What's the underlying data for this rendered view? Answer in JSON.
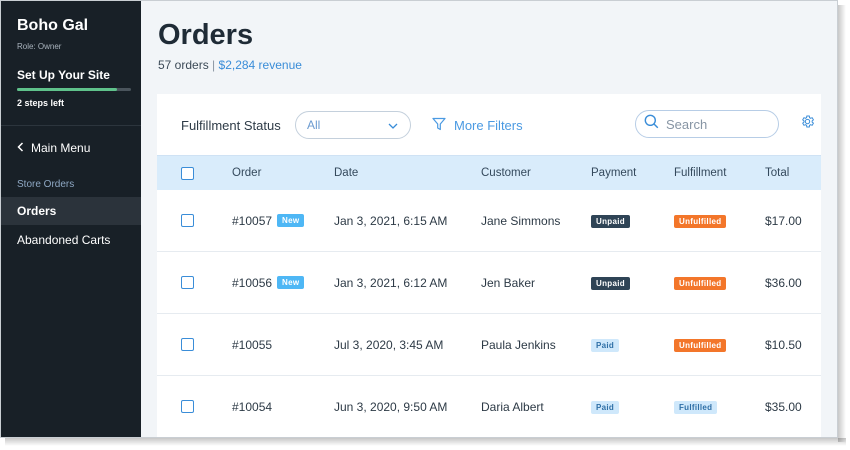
{
  "sidebar": {
    "site_name": "Boho Gal",
    "role": "Role: Owner",
    "setup_title": "Set Up Your Site",
    "setup_progress_percent": 88,
    "steps_left": "2 steps left",
    "main_menu_label": "Main Menu",
    "section_label": "Store Orders",
    "items": [
      {
        "label": "Orders",
        "active": true
      },
      {
        "label": "Abandoned Carts",
        "active": false
      }
    ]
  },
  "header": {
    "title": "Orders",
    "order_count": "57 orders",
    "separator": "|",
    "revenue": "$2,284 revenue"
  },
  "filters": {
    "fulfillment_label": "Fulfillment Status",
    "fulfillment_value": "All",
    "more_filters_label": "More Filters",
    "search_placeholder": "Search"
  },
  "table": {
    "columns": [
      "Order",
      "Date",
      "Customer",
      "Payment",
      "Fulfillment",
      "Total"
    ],
    "rows": [
      {
        "order": "#10057",
        "new": "New",
        "date": "Jan 3, 2021, 6:15 AM",
        "customer": "Jane Simmons",
        "payment": "Unpaid",
        "fulfillment": "Unfulfilled",
        "total": "$17.00"
      },
      {
        "order": "#10056",
        "new": "New",
        "date": "Jan 3, 2021, 6:12 AM",
        "customer": "Jen Baker",
        "payment": "Unpaid",
        "fulfillment": "Unfulfilled",
        "total": "$36.00"
      },
      {
        "order": "#10055",
        "new": "",
        "date": "Jul 3, 2020, 3:45 AM",
        "customer": "Paula Jenkins",
        "payment": "Paid",
        "fulfillment": "Unfulfilled",
        "total": "$10.50"
      },
      {
        "order": "#10054",
        "new": "",
        "date": "Jun 3, 2020, 9:50 AM",
        "customer": "Daria Albert",
        "payment": "Paid",
        "fulfillment": "Fulfilled",
        "total": "$35.00"
      }
    ]
  },
  "colors": {
    "sidebar_bg": "#182027",
    "accent": "#3a8dd8",
    "badge_new": "#4eb7f5",
    "badge_unpaid": "#2f4456",
    "badge_unfulfilled": "#f3762a",
    "progress": "#5fc28b"
  }
}
